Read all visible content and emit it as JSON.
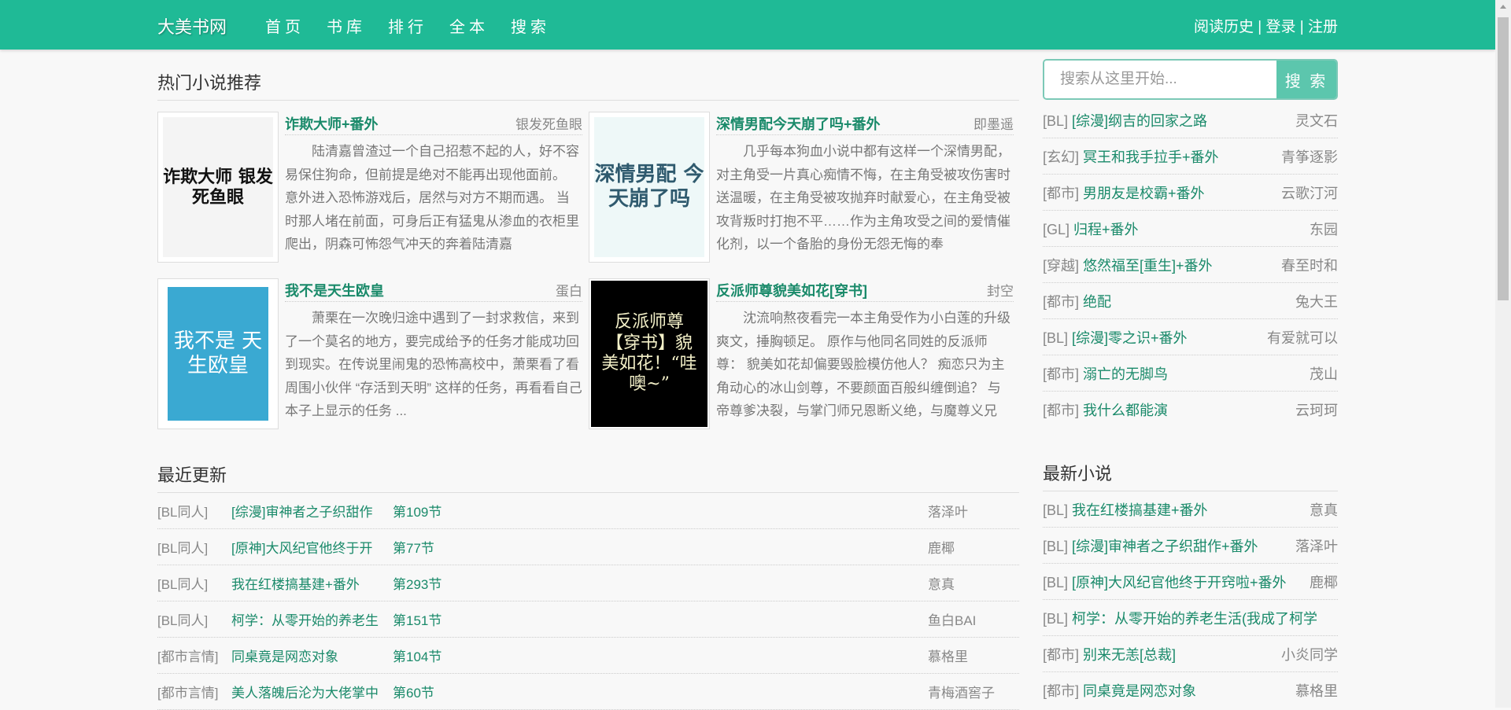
{
  "header": {
    "logo": "大美书网",
    "nav": [
      "首页",
      "书库",
      "排行",
      "全本",
      "搜索"
    ],
    "history": "阅读历史",
    "sep": "|",
    "login": "登录",
    "register": "注册"
  },
  "hot": {
    "title": "热门小说推荐",
    "books": [
      {
        "title": "诈欺大师+番外",
        "author": "银发死鱼眼",
        "desc": "陆清嘉曾渣过一个自己招惹不起的人，好不容易保住狗命，但前提是绝对不能再出现他面前。 意外进入恐怖游戏后，居然与对方不期而遇。 当时那人堵在前面，可身后正有猛鬼从渗血的衣柜里爬出，阴森可怖怨气冲天的奔着陆清嘉",
        "cover_text": "诈欺大师 银发死鱼眼"
      },
      {
        "title": "深情男配今天崩了吗+番外",
        "author": "即墨遥",
        "desc": "几乎每本狗血小说中都有这样一个深情男配，对主角受一片真心痴情不悔，在主角受被攻伤害时送温暖，在主角受被攻抛弃时献爱心，在主角受被攻背叛时打抱不平……作为主角攻受之间的爱情催化剂，以一个备胎的身份无怨无悔的奉",
        "cover_text": "深情男配 今天崩了吗"
      },
      {
        "title": "我不是天生欧皇",
        "author": "蛋白",
        "desc": "萧栗在一次晚归途中遇到了一封求救信，来到了一个莫名的地方，要完成给予的任务才能成功回到现实。在传说里闹鬼的恐怖高校中，萧栗看了看周围小伙伴 “存活到天明” 这样的任务，再看看自己本子上显示的任务 ...",
        "cover_text": "我不是 天生欧皇"
      },
      {
        "title": "反派师尊貌美如花[穿书]",
        "author": "封空",
        "desc": "沈流响熬夜看完一本主角受作为小白莲的升级爽文，捶胸顿足。 原作与他同名同姓的反派师尊： 貌美如花却偏要毁脸模仿他人？ 痴恋只为主角动心的冰山剑尊，不要颜面百般纠缠倒追？ 与帝尊爹决裂，与掌门师兄恩断义绝，与魔尊义兄",
        "cover_text": "反派师尊【穿书】貌美如花！“哇噢~”"
      }
    ]
  },
  "recent": {
    "title": "最近更新",
    "rows": [
      {
        "cat": "[BL同人]",
        "title": "[综漫]审神者之子织甜作",
        "chapter": "第109节",
        "author": "落泽叶"
      },
      {
        "cat": "[BL同人]",
        "title": "[原神]大风纪官他终于开",
        "chapter": "第77节",
        "author": "鹿椰"
      },
      {
        "cat": "[BL同人]",
        "title": "我在红楼搞基建+番外",
        "chapter": "第293节",
        "author": "意真"
      },
      {
        "cat": "[BL同人]",
        "title": "柯学：从零开始的养老生",
        "chapter": "第151节",
        "author": "鱼白BAI"
      },
      {
        "cat": "[都市言情]",
        "title": "同桌竟是网恋对象",
        "chapter": "第104节",
        "author": "慕格里"
      },
      {
        "cat": "[都市言情]",
        "title": "美人落魄后沦为大佬掌中",
        "chapter": "第60节",
        "author": "青梅酒窖子"
      }
    ]
  },
  "search": {
    "placeholder": "搜索从这里开始...",
    "button": "搜 索"
  },
  "side_hot": [
    {
      "cat": "[BL]",
      "title": "[综漫]纲吉的回家之路",
      "author": "灵文石"
    },
    {
      "cat": "[玄幻]",
      "title": "冥王和我手拉手+番外",
      "author": "青筝逐影"
    },
    {
      "cat": "[都市]",
      "title": "男朋友是校霸+番外",
      "author": "云歌汀河"
    },
    {
      "cat": "[GL]",
      "title": "归程+番外",
      "author": "东园"
    },
    {
      "cat": "[穿越]",
      "title": "悠然福至[重生]+番外",
      "author": "春至时和"
    },
    {
      "cat": "[都市]",
      "title": "绝配",
      "author": "兔大王"
    },
    {
      "cat": "[BL]",
      "title": "[综漫]零之识+番外",
      "author": "有爱就可以"
    },
    {
      "cat": "[都市]",
      "title": "溺亡的无脚鸟",
      "author": "茂山"
    },
    {
      "cat": "[都市]",
      "title": "我什么都能演",
      "author": "云珂珂"
    }
  ],
  "newest": {
    "title": "最新小说",
    "items": [
      {
        "cat": "[BL]",
        "title": "我在红楼搞基建+番外",
        "author": "意真"
      },
      {
        "cat": "[BL]",
        "title": "[综漫]审神者之子织甜作+番外",
        "author": "落泽叶"
      },
      {
        "cat": "[BL]",
        "title": "[原神]大风纪官他终于开窍啦+番外",
        "author": "鹿椰"
      },
      {
        "cat": "[BL]",
        "title": "柯学：从零开始的养老生活(我成了柯学",
        "author": ""
      },
      {
        "cat": "[都市]",
        "title": "别来无恙[总裁]",
        "author": "小炎同学"
      },
      {
        "cat": "[都市]",
        "title": "同桌竟是网恋对象",
        "author": "慕格里"
      }
    ]
  },
  "colors": {
    "brand": "#1fba96",
    "link": "#1a8a6a",
    "search_button": "#5cc6ad"
  }
}
